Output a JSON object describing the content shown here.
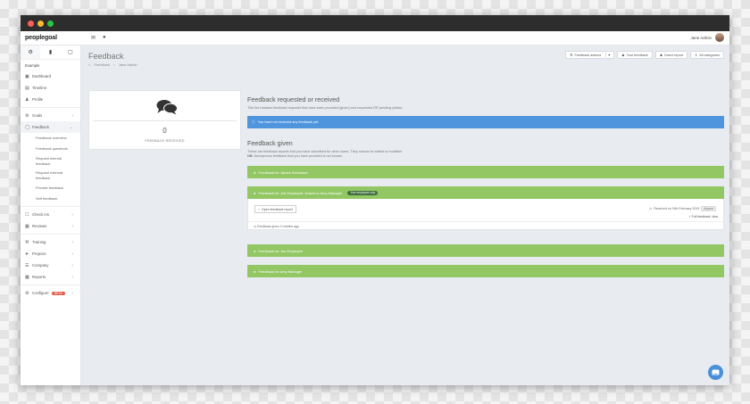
{
  "window": {
    "controls": [
      "#ff5f57",
      "#febc2e",
      "#28c840"
    ]
  },
  "app": {
    "logo": "peoplegoal",
    "user_name": "Jane Admin"
  },
  "sidebar": {
    "org_label": "Example",
    "items": {
      "dashboard": "Dashboard",
      "timeline": "Timeline",
      "profile": "Profile",
      "goals": "Goals",
      "feedback": "Feedback",
      "check_ins": "Check ins",
      "reviews": "Reviews",
      "training": "Training",
      "projects": "Projects",
      "company": "Company",
      "reports": "Reports",
      "configure": "Configure",
      "configure_badge": "BETA"
    },
    "feedback_sub": {
      "overview": "Feedback overview",
      "questions": "Feedback questions",
      "request_internal": "Request internal feedback",
      "request_external": "Request external feedback",
      "provide": "Provide feedback",
      "self": "Self feedback"
    }
  },
  "header": {
    "title": "Feedback",
    "breadcrumb": [
      "Feedback",
      "Jane Admin"
    ],
    "actions": {
      "feedback_actions": "Feedback actions",
      "your_feedback": "Your feedback",
      "direct_report": "Direct report",
      "all_categories": "All categories"
    }
  },
  "summary_card": {
    "count": "0",
    "label": "FEEDBACK RECEIVED"
  },
  "requested": {
    "title": "Feedback requested or received",
    "desc": "This list contains feedback requests that have been provided (given) and requested OR pending (while)",
    "alert": "You have not received any feedback yet."
  },
  "given": {
    "title": "Feedback given",
    "desc1": "These are feedback reports that you have submitted for other users. They cannot be edited or modified",
    "desc2_prefix": "NB:",
    "desc2": "Anonymous feedback that you have provided is not shown.",
    "bars": [
      {
        "label": "Feedback for James Strickland"
      },
      {
        "label": "Feedback for Joe Employee, shown to Amy Manager",
        "badge": "Your employee only"
      },
      {
        "label": "Feedback for Joe Employee"
      },
      {
        "label": "Feedback for Amy Manager"
      }
    ],
    "expanded": {
      "open_button": "Open feedback report",
      "received": "Received on 24th February 2019",
      "chip": "Anyone",
      "full": "Full feedback: idea",
      "given_ago": "Feedback given 2 months ago"
    }
  }
}
